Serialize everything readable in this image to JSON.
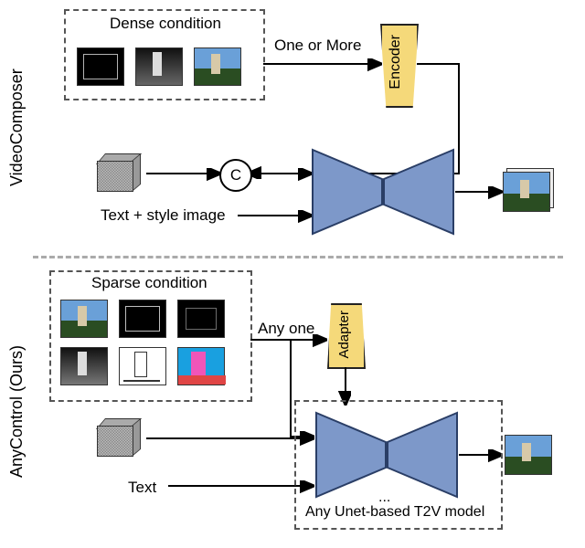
{
  "labels": {
    "top_method": "VideoComposer",
    "bottom_method": "AnyControl (Ours)",
    "dense_condition": "Dense condition",
    "sparse_condition": "Sparse condition",
    "one_or_more": "One or More",
    "any_one": "Any one",
    "encoder": "Encoder",
    "adapter": "Adapter",
    "concat": "C",
    "text_style": "Text + style image",
    "text": "Text",
    "any_unet": "Any Unet-based T2V model",
    "ellipsis": "..."
  },
  "top_panel": {
    "dense_conditions": [
      {
        "name": "edge-map",
        "desc": "edge map image"
      },
      {
        "name": "depth-map",
        "desc": "depth map image"
      },
      {
        "name": "rgb-image",
        "desc": "natural rgb lighthouse image"
      }
    ],
    "inputs": [
      "noise-latent",
      "text-plus-style-image"
    ],
    "modules": [
      "encoder",
      "concat",
      "unet-denoiser"
    ],
    "output": "generated-video-frames"
  },
  "bottom_panel": {
    "sparse_conditions": [
      {
        "name": "rgb-image",
        "desc": "rgb image"
      },
      {
        "name": "edge-white-on-black",
        "desc": "edge map"
      },
      {
        "name": "edge-dark",
        "desc": "dark edge map"
      },
      {
        "name": "depth-gray",
        "desc": "depth-like grayscale"
      },
      {
        "name": "sketch",
        "desc": "line sketch on white"
      },
      {
        "name": "segmentation",
        "desc": "colored segmentation map"
      }
    ],
    "inputs": [
      "noise-latent",
      "text"
    ],
    "modules": [
      "adapter",
      "any-unet-based-t2v"
    ],
    "output": "generated-video-frame"
  }
}
